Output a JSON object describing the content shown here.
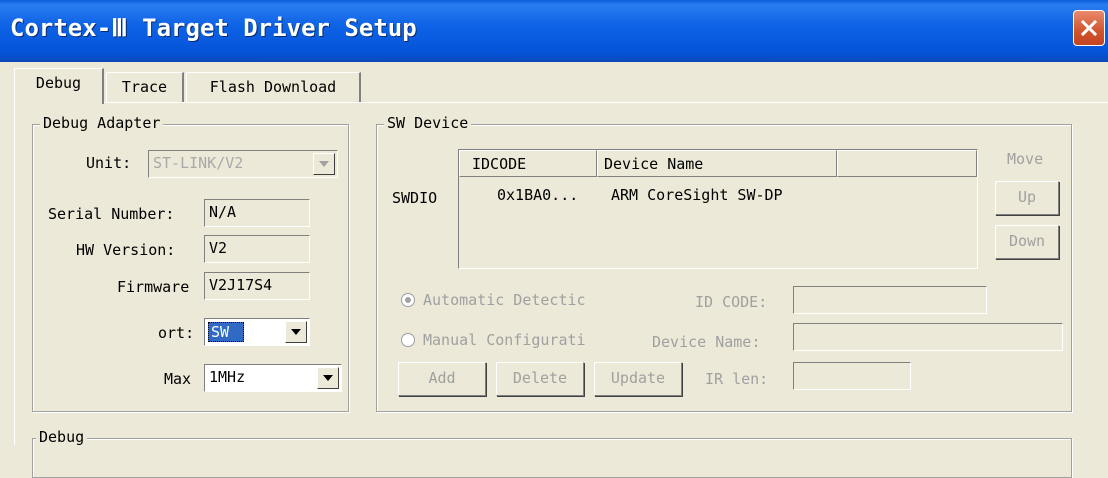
{
  "window": {
    "title": "Cortex-Ⅲ Target Driver Setup",
    "close_icon": "close-icon"
  },
  "tabs": [
    {
      "label": "Debug",
      "active": true
    },
    {
      "label": "Trace",
      "active": false
    },
    {
      "label": "Flash Download",
      "active": false
    }
  ],
  "debug_adapter": {
    "legend": "Debug Adapter",
    "unit_label": "Unit:",
    "unit_value": "ST-LINK/V2",
    "serial_label": "Serial Number:",
    "serial_value": "N/A",
    "hw_label": "HW Version:",
    "hw_value": "V2",
    "firmware_label": "Firmware",
    "firmware_value": "V2J17S4",
    "port_label": "ort:",
    "port_value": "SW",
    "max_label": "Max",
    "max_value": "1MHz"
  },
  "sw_device": {
    "legend": "SW Device",
    "row_label": "SWDIO",
    "columns": [
      "IDCODE",
      "Device Name",
      ""
    ],
    "rows": [
      {
        "idcode": "0x1BA0...",
        "name": "ARM CoreSight SW-DP"
      }
    ],
    "move_label": "Move",
    "up_label": "Up",
    "down_label": "Down",
    "auto_label": "Automatic Detectic",
    "manual_label": "Manual Configurati",
    "idcode_label": "ID CODE:",
    "device_name_label": "Device Name:",
    "ir_len_label": "IR len:",
    "add_label": "Add",
    "delete_label": "Delete",
    "update_label": "Update",
    "selected_mode": "auto"
  },
  "debug_group": {
    "legend": "Debug"
  },
  "colors": {
    "titlebar": "#0553d8",
    "dialog": "#ece9d8",
    "selection": "#316ac5"
  }
}
